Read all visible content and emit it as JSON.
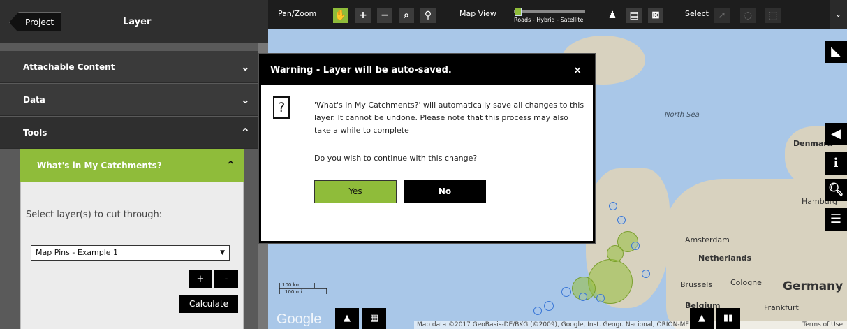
{
  "sidebar": {
    "project_label": "Project",
    "title": "Layer",
    "sections": [
      {
        "label": "Attachable Content",
        "state": "collapsed"
      },
      {
        "label": "Data",
        "state": "collapsed"
      },
      {
        "label": "Tools",
        "state": "expanded"
      }
    ],
    "tool": {
      "title": "What's in My Catchments?",
      "select_label": "Select layer(s) to cut through:",
      "selected_layer": "Map Pins - Example 1",
      "plus_label": "+",
      "minus_label": "-",
      "calculate_label": "Calculate"
    }
  },
  "toolbar": {
    "pan_zoom_label": "Pan/Zoom",
    "map_view_label": "Map View",
    "map_view_scale": "Roads - Hybrid - Satellite",
    "select_label": "Select"
  },
  "map": {
    "labels": {
      "north_sea": "North Sea",
      "denmark": "Denmark",
      "hamburg": "Hamburg",
      "amsterdam": "Amsterdam",
      "netherlands": "Netherlands",
      "brussels": "Brussels",
      "cologne": "Cologne",
      "germany": "Germany",
      "belgium": "Belgium",
      "frankfurt": "Frankfurt"
    },
    "scale_km": "100 km",
    "scale_mi": "100 mi",
    "google_logo": "Google",
    "attribution": "Map data ©2017 GeoBasis-DE/BKG (©2009), Google, Inst. Geogr. Nacional, ORION-ME",
    "terms": "Terms of Use"
  },
  "modal": {
    "title": "Warning - Layer will be auto-saved.",
    "close_symbol": "×",
    "question_symbol": "?",
    "message": "'What's In My Catchments?' will automatically save all changes to this layer. It cannot be undone. Please note that this process may also take a while to complete",
    "question": "Do you wish to continue with this change?",
    "yes_label": "Yes",
    "no_label": "No"
  },
  "colors": {
    "accent_green": "#8fbc3a",
    "toolbar_bg": "#1d1d1d",
    "sidebar_bg": "#3a3a3a"
  }
}
